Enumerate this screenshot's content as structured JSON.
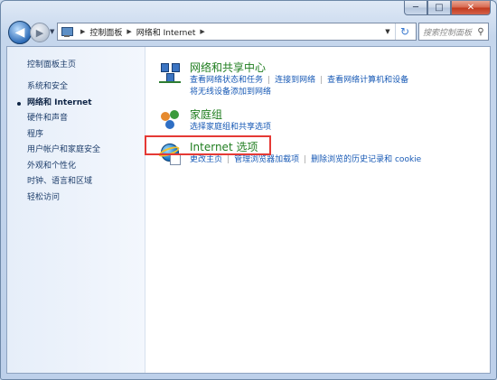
{
  "window": {
    "controls": {
      "minimize": "─",
      "maximize": "□",
      "close": "✕"
    }
  },
  "navigation": {
    "back_icon": "back-arrow-icon",
    "forward_icon": "forward-arrow-icon",
    "breadcrumbs": [
      "控制面板",
      "网络和 Internet"
    ],
    "search_placeholder": "搜索控制面板"
  },
  "sidebar": {
    "home": "控制面板主页",
    "items": [
      {
        "label": "系统和安全",
        "active": false
      },
      {
        "label": "网络和 Internet",
        "active": true
      },
      {
        "label": "硬件和声音",
        "active": false
      },
      {
        "label": "程序",
        "active": false
      },
      {
        "label": "用户帐户和家庭安全",
        "active": false
      },
      {
        "label": "外观和个性化",
        "active": false
      },
      {
        "label": "时钟、语言和区域",
        "active": false
      },
      {
        "label": "轻松访问",
        "active": false
      }
    ]
  },
  "categories": [
    {
      "title": "网络和共享中心",
      "icon": "network-sharing-icon",
      "links": [
        "查看网络状态和任务",
        "连接到网络",
        "查看网络计算机和设备",
        "将无线设备添加到网络"
      ]
    },
    {
      "title": "家庭组",
      "icon": "homegroup-icon",
      "links": [
        "选择家庭组和共享选项"
      ]
    },
    {
      "title": "Internet 选项",
      "icon": "internet-options-icon",
      "links": [
        "更改主页",
        "管理浏览器加载项",
        "删除浏览的历史记录和 cookie"
      ],
      "highlighted": true
    }
  ],
  "colors": {
    "category_title": "#1f7d1f",
    "link": "#1759b5",
    "highlight_border": "#e53935"
  }
}
